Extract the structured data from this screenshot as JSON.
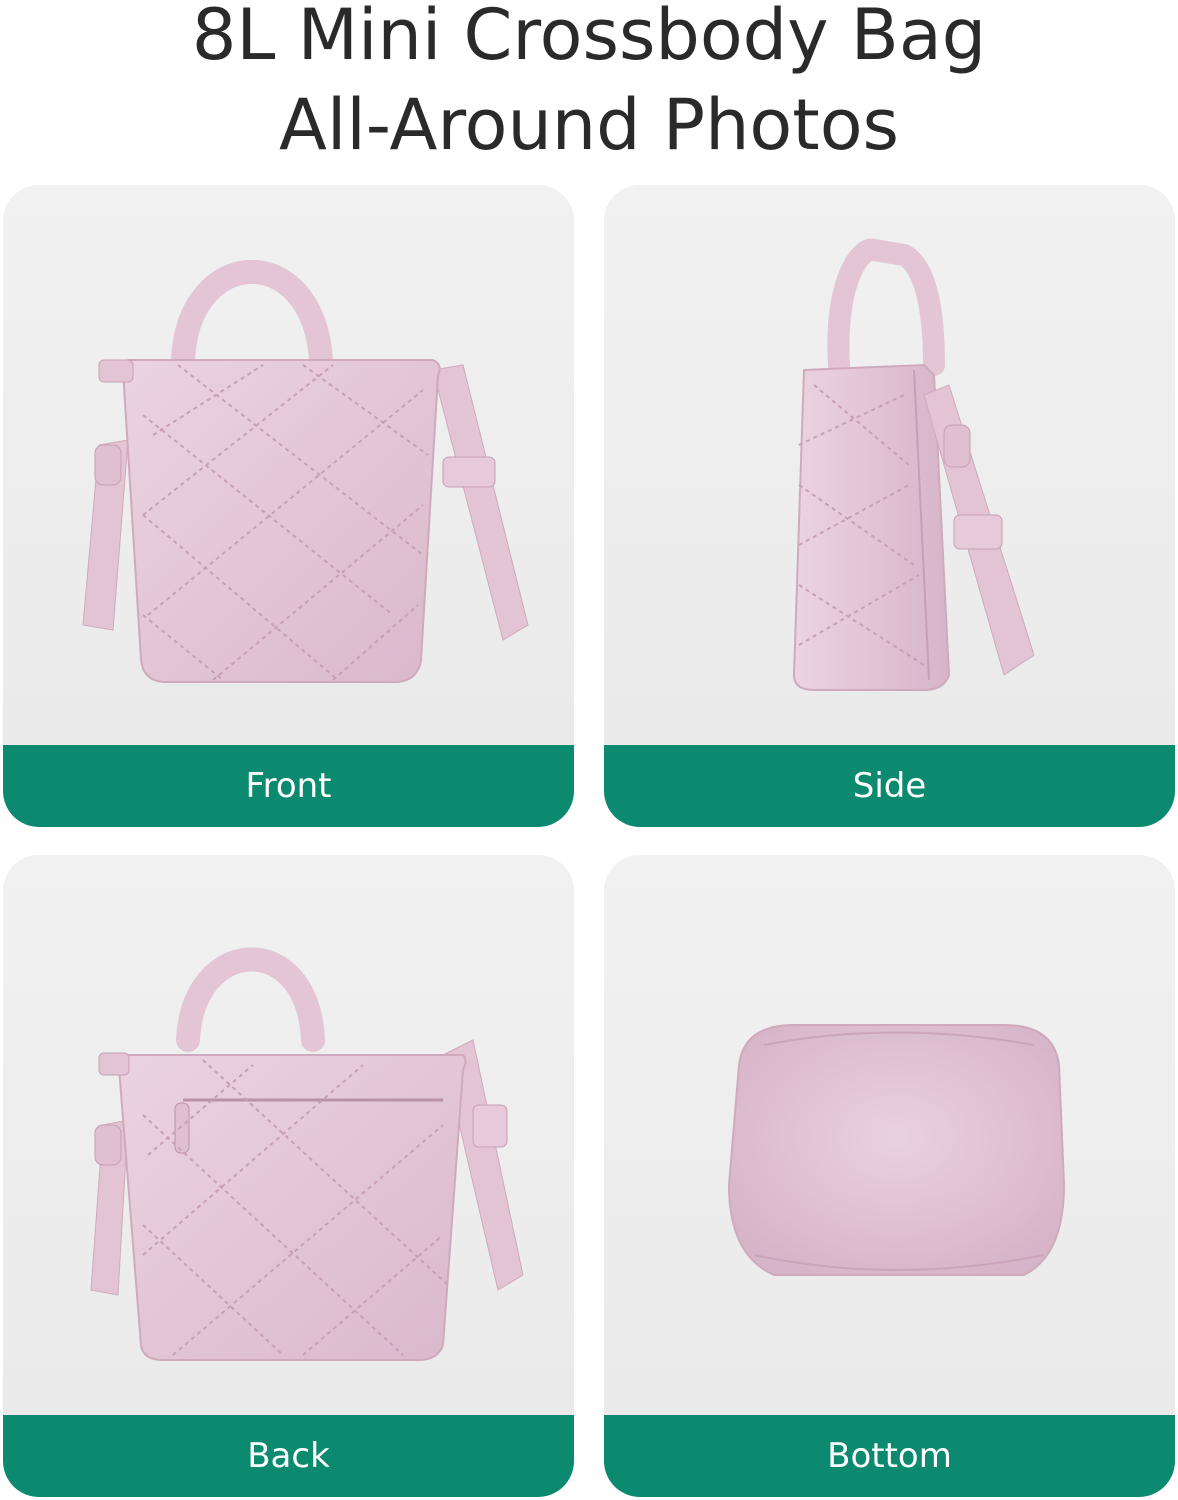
{
  "title": {
    "line1": "8L Mini Crossbody Bag",
    "line2": "All-Around Photos"
  },
  "colors": {
    "accent": "#0b8a6f",
    "bag": "#e6cad9",
    "card_bg": "#ededed"
  },
  "cards": [
    {
      "label": "Front",
      "image": "pink-quilted-bag-front"
    },
    {
      "label": "Side",
      "image": "pink-quilted-bag-side"
    },
    {
      "label": "Back",
      "image": "pink-quilted-bag-back"
    },
    {
      "label": "Bottom",
      "image": "pink-quilted-bag-bottom"
    }
  ]
}
